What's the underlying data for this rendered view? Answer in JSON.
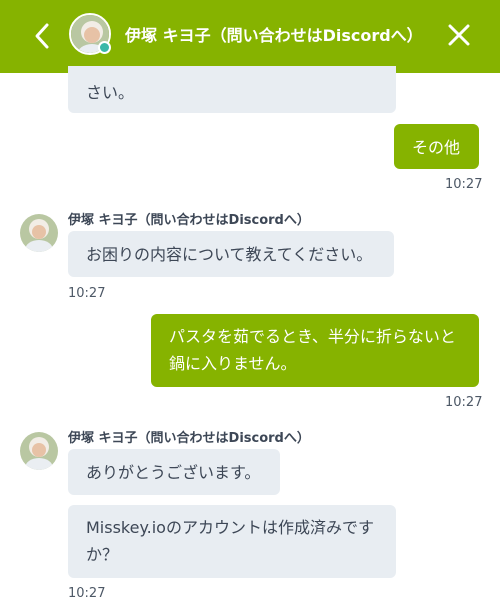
{
  "header": {
    "title": "伊塚 キヨ子（問い合わせはDiscordへ）",
    "back_icon": "chevron-left-icon",
    "close_icon": "close-icon",
    "online_status_color": "#3ab8a8",
    "bar_color": "#86b300"
  },
  "messages": [
    {
      "from": "other",
      "text": "さい。"
    },
    {
      "from": "me",
      "text": "その他",
      "time": "10:27"
    },
    {
      "from": "other",
      "sender": "伊塚 キヨ子（問い合わせはDiscordへ）",
      "text": "お困りの内容について教えてください。",
      "time": "10:27"
    },
    {
      "from": "me",
      "lines": [
        "パスタを茹でるとき、半分に折らないと",
        "鍋に入りません。"
      ],
      "time": "10:27"
    },
    {
      "from": "other",
      "sender": "伊塚 キヨ子（問い合わせはDiscordへ）",
      "text": "ありがとうございます。"
    },
    {
      "from": "other",
      "lines": [
        "Misskey.ioのアカウントは作成済みです",
        "か？"
      ],
      "time": "10:27"
    }
  ]
}
